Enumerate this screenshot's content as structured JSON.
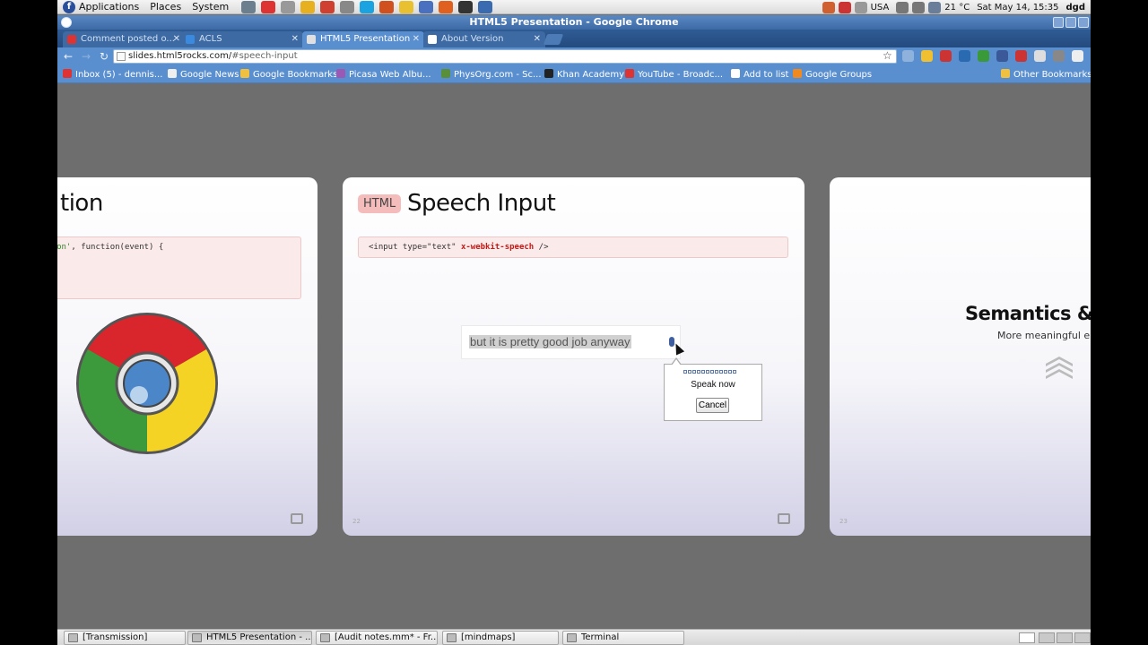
{
  "panel": {
    "menus": [
      "Applications",
      "Places",
      "System"
    ],
    "launchers": [
      {
        "icon": "monitor-icon",
        "color": "#6b7f8f"
      },
      {
        "icon": "chrome-icon",
        "color": "#d33"
      },
      {
        "icon": "home-icon",
        "color": "#999"
      },
      {
        "icon": "notes-icon",
        "color": "#e6b020"
      },
      {
        "icon": "alarm-clock-icon",
        "color": "#d04030"
      },
      {
        "icon": "gear-icon",
        "color": "#888"
      },
      {
        "icon": "skype-icon",
        "color": "#1aa3e0"
      },
      {
        "icon": "tools-icon",
        "color": "#d05020"
      },
      {
        "icon": "star-icon",
        "color": "#e8c030"
      },
      {
        "icon": "notes-music-icon",
        "color": "#4a70c0"
      },
      {
        "icon": "firefox-icon",
        "color": "#e06020"
      },
      {
        "icon": "terminal-icon",
        "color": "#333"
      },
      {
        "icon": "update-icon",
        "color": "#3a6bb0"
      }
    ],
    "keyboard_layout": "USA",
    "temperature": "21 °C",
    "clock": "Sat May 14, 15:35",
    "user": "dgd"
  },
  "window": {
    "title": "HTML5 Presentation - Google Chrome"
  },
  "tabs": [
    {
      "label": "Comment posted o...",
      "icon_color": "#d33",
      "active": false
    },
    {
      "label": "ACLS",
      "icon_color": "#3a8ae0",
      "active": false
    },
    {
      "label": "HTML5 Presentation",
      "icon_color": "#e0e0e0",
      "active": true
    },
    {
      "label": "About Version",
      "icon_color": "#ffffff",
      "active": false
    }
  ],
  "address": {
    "host": "slides.html5rocks.com/",
    "fragment": "#speech-input"
  },
  "bookmarks": [
    {
      "label": "Inbox (5) - dennis...",
      "icon_color": "#d33"
    },
    {
      "label": "Google News",
      "icon_color": "#eee"
    },
    {
      "label": "Google Bookmarks",
      "icon_color": "#f0c040"
    },
    {
      "label": "Picasa Web Albu...",
      "icon_color": "#9b59b6"
    },
    {
      "label": "PhysOrg.com - Sc...",
      "icon_color": "#5a8f3a"
    },
    {
      "label": "Khan Academy",
      "icon_color": "#222"
    },
    {
      "label": "YouTube - Broadc...",
      "icon_color": "#d33"
    },
    {
      "label": "Add to list",
      "icon_color": "#fff"
    },
    {
      "label": "Google Groups",
      "icon_color": "#f08a20"
    },
    {
      "label": "Other Bookmarks",
      "icon_color": "#f0c040"
    }
  ],
  "slide_left": {
    "title_fragment": "tion",
    "code_line_str": "ntation'",
    "code_line_rest": ", function(event) {"
  },
  "slide_mid": {
    "badge": "HTML",
    "title": "Speech Input",
    "code_prefix": "<input type=\"text\" ",
    "code_attr": "x-webkit-speech",
    "code_suffix": " />",
    "input_value": "but it is pretty good job anyway",
    "bubble_speak": "Speak now",
    "bubble_cancel": "Cancel",
    "number": "22"
  },
  "slide_right": {
    "title": "Semantics & M",
    "subtitle": "More meaningful ele",
    "number": "23"
  },
  "taskbar": [
    {
      "label": "[Transmission]",
      "active": false
    },
    {
      "label": "HTML5 Presentation - ...",
      "active": true
    },
    {
      "label": "[Audit notes.mm* - Fr...",
      "active": false
    },
    {
      "label": "[mindmaps]",
      "active": false
    },
    {
      "label": "Terminal",
      "active": false
    }
  ]
}
